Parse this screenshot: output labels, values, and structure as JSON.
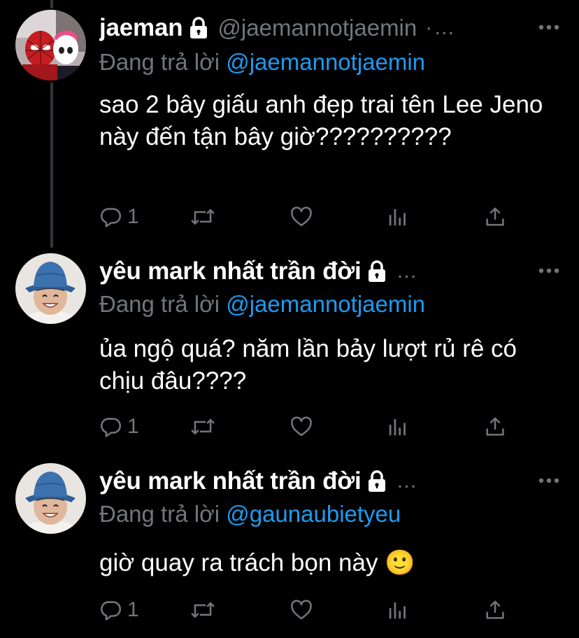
{
  "tweets": [
    {
      "name": "jaeman",
      "handle": "@jaemannotjaemin",
      "dots": "·…",
      "reply_prefix": "Đang trả lời",
      "reply_mention": "@jaemannotjaemin",
      "text": "sao 2 bây giấu anh đẹp trai tên Lee Jeno này đến tận bây giờ??????????",
      "reply_count": "1",
      "avatar": "spiderman-avatar"
    },
    {
      "name": "yêu mark nhất trần đời",
      "handle": "",
      "dots": "…",
      "reply_prefix": "Đang trả lời",
      "reply_mention": "@jaemannotjaemin",
      "text": "ủa ngộ quá? năm lần bảy lượt rủ rê có chịu đâu????",
      "reply_count": "1",
      "avatar": "bucket-hat-avatar"
    },
    {
      "name": "yêu mark nhất trần đời",
      "handle": "",
      "dots": "…",
      "reply_prefix": "Đang trả lời",
      "reply_mention": "@gaunaubietyeu",
      "text": "giờ quay ra trách bọn này 🙂",
      "reply_count": "1",
      "avatar": "bucket-hat-avatar"
    }
  ],
  "icons": {
    "reply": "reply-icon",
    "retweet": "retweet-icon",
    "like": "heart-icon",
    "analytics": "analytics-icon",
    "share": "share-icon",
    "lock": "lock-icon",
    "more": "more-icon"
  },
  "colors": {
    "background": "#000000",
    "text": "#ffffff",
    "secondary": "#71767b",
    "mention": "#1d9bf0",
    "thread_line": "#333639"
  }
}
